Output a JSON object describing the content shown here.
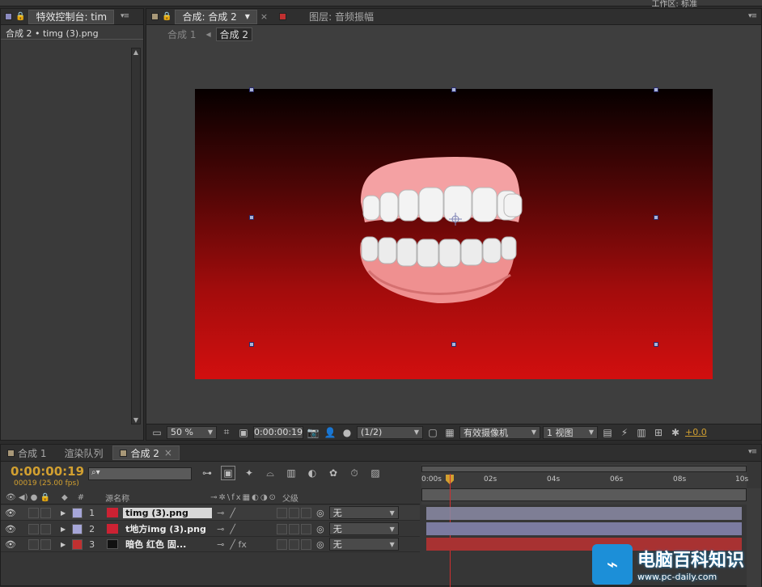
{
  "top": {
    "workspace": "工作区:",
    "workspace_value": "标准"
  },
  "effects_panel": {
    "tab_label": "特效控制台: tim",
    "title": "合成 2 • timg (3).png"
  },
  "comp_panel": {
    "tab_comp": "合成: 合成 2",
    "tab_layer": "图层: 音频振幅",
    "breadcrumb": [
      "合成 1",
      "合成 2"
    ],
    "zoom": "50 %",
    "timecode": "0:00:00:19",
    "resolution": "(1/2)",
    "camera": "有效摄像机",
    "views": "1 视图",
    "exposure": "+0.0"
  },
  "bottom_tabs": [
    {
      "label": "合成 1"
    },
    {
      "label": "渲染队列"
    },
    {
      "label": "合成 2"
    }
  ],
  "timeline": {
    "timecode": "0:00:00:19",
    "frames": "00019 (25.00 fps)",
    "search_placeholder": "",
    "ruler": [
      "0:00s",
      "02s",
      "04s",
      "06s",
      "08s",
      "10s"
    ],
    "header": {
      "num": "#",
      "source": "源名称",
      "parent": "父级"
    },
    "layers": [
      {
        "num": "1",
        "name": "timg (3).png",
        "parent": "无",
        "color": "#a6a6d8",
        "bar": "#8b8ba6"
      },
      {
        "num": "2",
        "name": "t地方img (3).png",
        "parent": "无",
        "color": "#a6a6d8",
        "bar": "#7b7ba0"
      },
      {
        "num": "3",
        "name": "暗色 红色 固...",
        "parent": "无",
        "color": "#c03030",
        "bar": "#a83232"
      }
    ]
  },
  "watermark": {
    "title": "电脑百科知识",
    "url": "www.pc-daily.com"
  },
  "colors": {
    "accent_timecode": "#d2a030",
    "playhead": "#d03030",
    "bg_red": "#d20f0f"
  }
}
